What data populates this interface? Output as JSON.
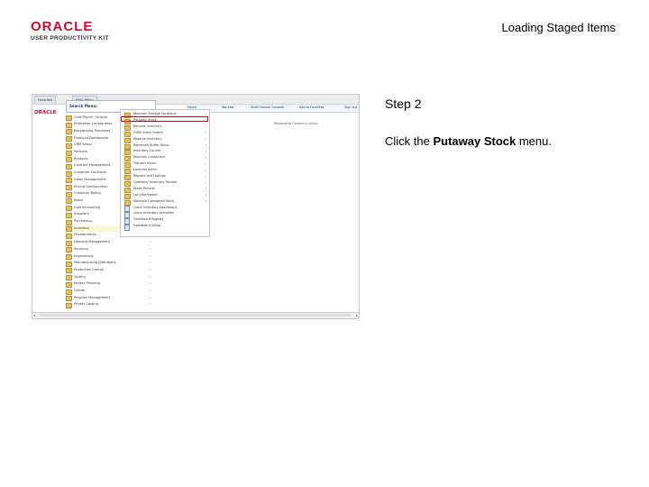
{
  "header": {
    "logo_oracle": "ORACLE",
    "logo_subtitle": "USER PRODUCTIVITY KIT",
    "page_title": "Loading Staged Items"
  },
  "step": {
    "number": "Step 2",
    "instruction_prefix": "Click the ",
    "instruction_bold": "Putaway Stock",
    "instruction_suffix": " menu."
  },
  "screenshot": {
    "tabs": [
      "Favorites",
      "Main Menu"
    ],
    "menu_title": "Search Menu:",
    "oracle_mini": "ORACLE",
    "toolbar": [
      "Home",
      "Worklist",
      "MultiChannel Console",
      "Add to Favorites",
      "Sign out"
    ],
    "personalize": "Personalize Content | Layout",
    "nav_items": [
      {
        "label": "Core Payroll Console",
        "arrow": "›"
      },
      {
        "label": "Enterprise Components",
        "arrow": "›"
      },
      {
        "label": "Background Processes",
        "arrow": "›"
      },
      {
        "label": "Financial Dashboards",
        "arrow": "›"
      },
      {
        "label": "CRM Setup",
        "arrow": "›"
      },
      {
        "label": "Partners",
        "arrow": "›"
      },
      {
        "label": "Products",
        "arrow": "›"
      },
      {
        "label": "Contract Management",
        "arrow": "›"
      },
      {
        "label": "Customer Contracts",
        "arrow": "›"
      },
      {
        "label": "Order Management",
        "arrow": "›"
      },
      {
        "label": "Pricing Configuration",
        "arrow": "›"
      },
      {
        "label": "Customer Billing",
        "arrow": "›"
      },
      {
        "label": "Items",
        "arrow": "›"
      },
      {
        "label": "Cost Accounting",
        "arrow": "›"
      },
      {
        "label": "Suppliers",
        "arrow": "›"
      },
      {
        "label": "Purchasing",
        "arrow": "›"
      },
      {
        "label": "Inventory",
        "arrow": "›"
      },
      {
        "label": "Environments",
        "arrow": "›"
      },
      {
        "label": "Demand Management",
        "arrow": "›"
      },
      {
        "label": "Sourcing",
        "arrow": "›"
      },
      {
        "label": "Engineering",
        "arrow": "›"
      },
      {
        "label": "Manufacturing Definitions",
        "arrow": "›"
      },
      {
        "label": "Production Control",
        "arrow": "›"
      },
      {
        "label": "Quality",
        "arrow": "›"
      },
      {
        "label": "Project Planning",
        "arrow": "›"
      },
      {
        "label": "Grants",
        "arrow": "›"
      },
      {
        "label": "Program Management",
        "arrow": "›"
      },
      {
        "label": "Project Costing",
        "arrow": "›"
      }
    ],
    "highlight_index": 16,
    "flyout_items": [
      {
        "label": "Maintain Storage Locations",
        "type": "folder",
        "arrow": "›"
      },
      {
        "label": "Putaway Stock",
        "type": "folder",
        "arrow": "›"
      },
      {
        "label": "Receive Inventory",
        "type": "folder",
        "arrow": "›"
      },
      {
        "label": "Fulfill Stock Orders",
        "type": "folder",
        "arrow": "›"
      },
      {
        "label": "Reserve Inventory",
        "type": "folder",
        "arrow": "›"
      },
      {
        "label": "Replenish Buffer Stock",
        "type": "folder",
        "arrow": "›"
      },
      {
        "label": "Inventory Counts",
        "type": "folder",
        "arrow": "›"
      },
      {
        "label": "Maintain Containers",
        "type": "folder",
        "arrow": "›"
      },
      {
        "label": "Transfer Items",
        "type": "folder",
        "arrow": "›"
      },
      {
        "label": "Forecast Items",
        "type": "folder",
        "arrow": "›"
      },
      {
        "label": "Reports and Listings",
        "type": "folder",
        "arrow": "›"
      },
      {
        "label": "Quarterly Inventory Review",
        "type": "folder",
        "arrow": "›"
      },
      {
        "label": "Stock Periods",
        "type": "folder",
        "arrow": "›"
      },
      {
        "label": "Lot Information",
        "type": "folder",
        "arrow": "›"
      },
      {
        "label": "Maintain Consigned Stock",
        "type": "folder",
        "arrow": "›"
      },
      {
        "label": "Quick Inventory Dashboard",
        "type": "page",
        "arrow": ""
      },
      {
        "label": "Quick Inventory Activities",
        "type": "page",
        "arrow": ""
      },
      {
        "label": "Dashboard Pagelet",
        "type": "page",
        "arrow": ""
      },
      {
        "label": "Dashboard Setup",
        "type": "page",
        "arrow": ""
      }
    ]
  }
}
